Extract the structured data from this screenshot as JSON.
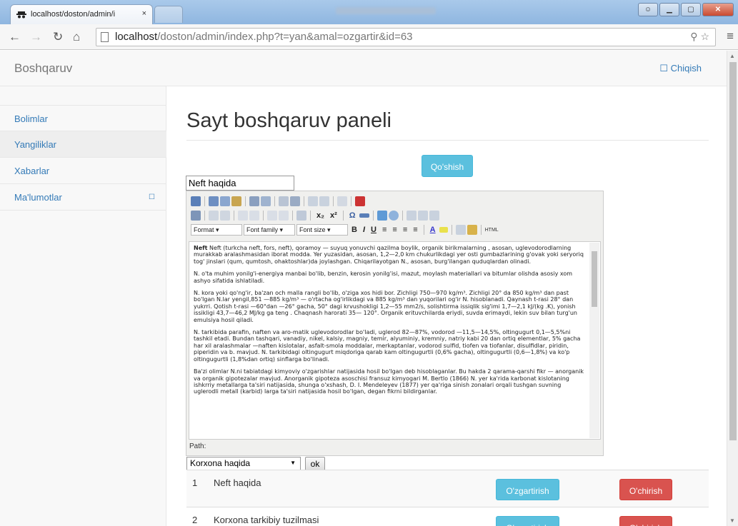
{
  "browser": {
    "tab_title": "localhost/doston/admin/i",
    "tab_close": "×",
    "url_host": "localhost",
    "url_path": "/doston/admin/index.php?t=yan&amal=ozgartir&id=63"
  },
  "navbar": {
    "brand": "Boshqaruv",
    "logout": "Chiqish"
  },
  "sidebar": {
    "items": [
      {
        "label": "Bolimlar"
      },
      {
        "label": "Yangiliklar"
      },
      {
        "label": "Xabarlar"
      },
      {
        "label": "Ma'lumotlar"
      }
    ]
  },
  "page": {
    "title": "Sayt boshqaruv paneli",
    "add_button": "Qo'shish",
    "title_field_value": "Neft haqida"
  },
  "editor": {
    "format_label": "Format",
    "font_family_label": "Font family",
    "font_size_label": "Font size",
    "path_label": "Path:",
    "paragraphs": [
      "Neft (turkcha neft, fors, neft), qoramoy — suyuq yonuvchi qazilma boylik, organik birikmalarning , asosan, uglevodorodlarning murakkab aralashmasidan iborat modda. Yer yuzasidan, asosan, 1,2—2,0 km chukurlikdagi yer osti gumbazlarining g'ovak yoki seryoriq tog' jinslari (qum, qumtosh, ohaktoshlar)da joylashgan. Chiqarilayotgan N., asosan, burg'ilangan quduqlardan olinadi.",
      "N. o'ta muhim yonilg'i-energiya manbai bo'lib, benzin, kerosin yonilg'isi, mazut, moylash materiallari va bitumlar olishda asosiy xom ashyo sifatida ishlatiladi.",
      "N. kora yoki qo'ng'ir, ba'zan och malla rangli bo'lib, o'ziga xos hidi bor. Zichligi 750—970 kg/m³. Zichligi 20° da 850 kg/m³ dan past bo'lgan N.lar yengil,851 —885 kg/m³ — o'rtacha og'irlikdagi va 885 kg/m³ dan yuqorilari og'ir N. hisoblanadi. Qaynash t-rasi 28° dan yukrri. Qotish t-rasi —60°dan —26° gacha, 50° dagi krvushokligi 1,2—55 mm2/s, solishtirma issiqlik sig'imi 1,7—2,1 kJ/(kg .K), yonish issikligi 43,7—46,2 MJ/kg ga teng . Chaqnash harorati 35— 120°. Organik erituvchilarda eriydi, suvda erimaydi, lekin suv bilan turg'un emulsiya hosil qiladi.",
      "N. tarkibida parafin, naften va aro-matik uglevodorodlar bo'ladi, uglerod 82—87%, vodorod —11,5—14,5%, oltingugurt 0,1—5,5%ni tashkil etadi. Bundan tashqari, vanadiy, nikel, kalsiy, magniy, temir, alyuminiy, kremniy, natriy kabi 20 dan ortiq elementlar, 5% gacha har xil aralashmalar —naften kislotalar, asfalt-smola moddalar, merkaptanlar, vodorod sulfid, tiofen va tiofanlar, disulfidlar, piridin, piperidin va b. mavjud. N. tarkibidagi oltingugurt miqdoriga qarab kam oltingugurtli (0,6% gacha), oltingugurtli (0,6—1,8%) va ko'p oltingugurtli (1,8%dan ortiq) sinflarga bo'linadi.",
      "Ba'zi olimlar N.ni tabiatdagi kimyoviy o'zgarishlar natijasida hosil bo'lgan deb hisoblaganlar. Bu hakda 2 qarama-qarshi fikr — anorganik va organik gipotezalar mavjud. Anorganik gipoteza asoschisi fransuz kimyogari M. Bertlo (1866) N. yer ka'rida karbonat kislotaning ishkrriy metallarga ta'siri natijasida, shunga o'xshash, D. I. Mendeleyev (1877) yer qa'riga sinish zonalari orqali tushgan suvning uglerodli metall (karbid) larga ta'siri natijasida hosil bo'lgan, degan fikrni bildirganlar."
    ]
  },
  "section_select": {
    "value": "Korxona haqida",
    "ok": "ok"
  },
  "table": {
    "rows": [
      {
        "num": "1",
        "name": "Neft haqida",
        "edit": "O'zgartirish",
        "delete": "O'chirish"
      },
      {
        "num": "2",
        "name": "Korxona tarkibiy tuzilmasi",
        "edit": "O'zgartirish",
        "delete": "O'chirish"
      }
    ]
  }
}
